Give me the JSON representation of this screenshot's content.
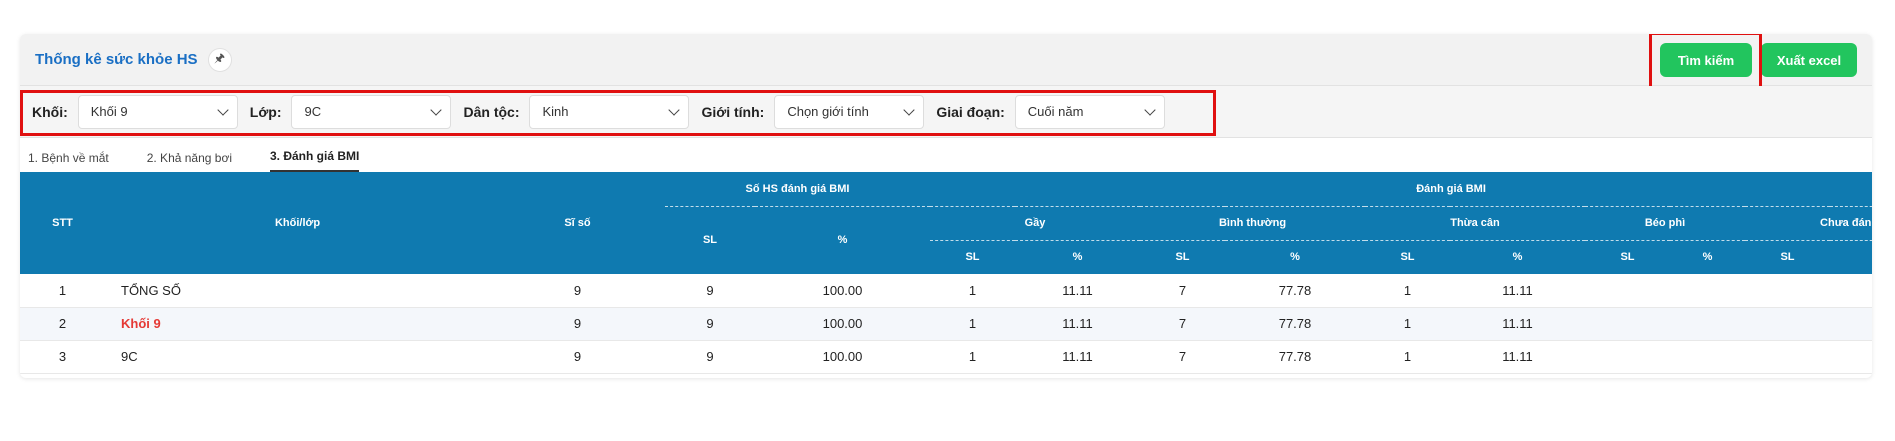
{
  "header": {
    "title": "Thống kê sức khỏe HS",
    "pin_icon": "pin-icon"
  },
  "actions": {
    "search": "Tìm kiếm",
    "excel": "Xuất excel"
  },
  "filters": {
    "khoi": {
      "label": "Khối:",
      "value": "Khối 9"
    },
    "lop": {
      "label": "Lớp:",
      "value": "9C"
    },
    "dantoc": {
      "label": "Dân tộc:",
      "value": "Kinh"
    },
    "gioitinh": {
      "label": "Giới tính:",
      "value": "Chọn giới tính"
    },
    "giaidoan": {
      "label": "Giai đoạn:",
      "value": "Cuối năm"
    }
  },
  "tabs": [
    "1. Bệnh về mắt",
    "2. Khả năng bơi",
    "3. Đánh giá BMI"
  ],
  "table": {
    "headers": {
      "stt": "STT",
      "khoilop": "Khối/lớp",
      "siso": "Sĩ số",
      "so_hs": "Số HS đánh giá BMI",
      "danh_gia": "Đánh giá BMI",
      "sl": "SL",
      "pct": "%",
      "gay": "Gầy",
      "binhthuong": "Bình thường",
      "thuacan": "Thừa cân",
      "beophi": "Béo phì",
      "chuadanhgia": "Chưa đánh giá"
    },
    "rows": [
      {
        "stt": "1",
        "name": "TỔNG SỐ",
        "siso": "9",
        "sl": "9",
        "pct": "100.00",
        "gay_sl": "1",
        "gay_pct": "11.11",
        "bt_sl": "7",
        "bt_pct": "77.78",
        "tc_sl": "1",
        "tc_pct": "11.11",
        "bp_sl": "",
        "bp_pct": "",
        "cdg_sl": "",
        "cdg_pct": ""
      },
      {
        "stt": "2",
        "name": "Khối 9",
        "siso": "9",
        "sl": "9",
        "pct": "100.00",
        "gay_sl": "1",
        "gay_pct": "11.11",
        "bt_sl": "7",
        "bt_pct": "77.78",
        "tc_sl": "1",
        "tc_pct": "11.11",
        "bp_sl": "",
        "bp_pct": "",
        "cdg_sl": "",
        "cdg_pct": ""
      },
      {
        "stt": "3",
        "name": "9C",
        "siso": "9",
        "sl": "9",
        "pct": "100.00",
        "gay_sl": "1",
        "gay_pct": "11.11",
        "bt_sl": "7",
        "bt_pct": "77.78",
        "tc_sl": "1",
        "tc_pct": "11.11",
        "bp_sl": "",
        "bp_pct": "",
        "cdg_sl": "",
        "cdg_pct": ""
      }
    ]
  },
  "colors": {
    "accent_green": "#22c55e",
    "header_blue": "#0f7ab0",
    "title_blue": "#1a6fc4",
    "highlight_red": "#e01010",
    "group_red": "#e53935"
  }
}
